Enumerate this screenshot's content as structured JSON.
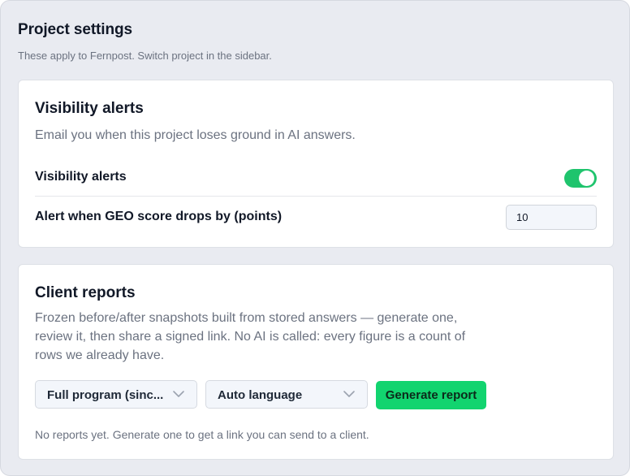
{
  "header": {
    "title": "Project settings",
    "subtitle": "These apply to Fernpost. Switch project in the sidebar."
  },
  "visibility": {
    "title": "Visibility alerts",
    "description": "Email you when this project loses ground in AI answers.",
    "toggle_label": "Visibility alerts",
    "toggle_on": true,
    "threshold_label": "Alert when GEO score drops by (points)",
    "threshold_value": "10"
  },
  "reports": {
    "title": "Client reports",
    "description_lines": [
      "Frozen before/after snapshots built from stored answers — generate one,",
      "review it, then share a signed link. No AI is called: every figure is a count of",
      "rows we already have."
    ],
    "period_select": "Full program (sinc...",
    "language_select": "Auto language",
    "generate_label": "Generate report",
    "empty_note": "No reports yet. Generate one to get a link you can send to a client."
  },
  "icons": {
    "toggle_color": "#1fc46d",
    "chevron": "chevron-down-icon"
  },
  "colors": {
    "accent": "#12d46f",
    "toggle_on": "#1fc46d"
  }
}
